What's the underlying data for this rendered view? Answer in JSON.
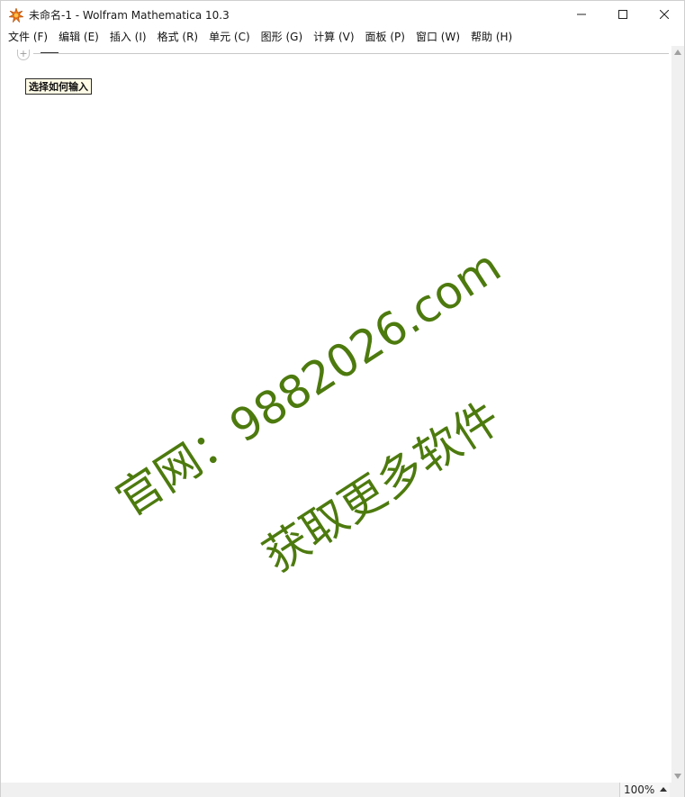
{
  "window": {
    "title": "未命名-1 - Wolfram Mathematica 10.3"
  },
  "menu": {
    "items": [
      {
        "label": "文件 (F)"
      },
      {
        "label": "编辑 (E)"
      },
      {
        "label": "插入 (I)"
      },
      {
        "label": "格式 (R)"
      },
      {
        "label": "单元 (C)"
      },
      {
        "label": "图形 (G)"
      },
      {
        "label": "计算 (V)"
      },
      {
        "label": "面板 (P)"
      },
      {
        "label": "窗口 (W)"
      },
      {
        "label": "帮助 (H)"
      }
    ]
  },
  "notebook": {
    "insert_cell_symbol": "+",
    "input_hint": "选择如何输入"
  },
  "watermark": {
    "line1": "官网：9882026.com",
    "line2": "获取更多软件",
    "color": "#4d7a0e"
  },
  "status": {
    "zoom": "100%"
  }
}
